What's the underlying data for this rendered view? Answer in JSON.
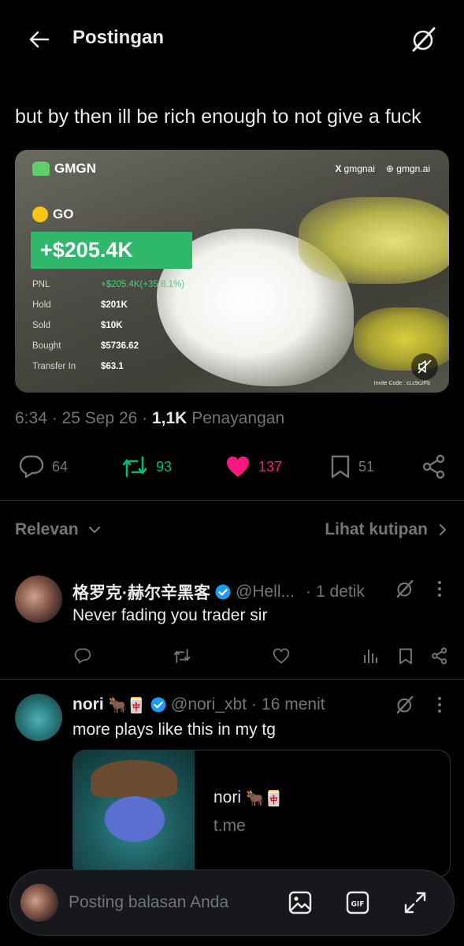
{
  "header": {
    "title": "Postingan",
    "back_icon": "arrow-left-icon",
    "grok_icon": "grok-icon"
  },
  "post": {
    "text": "but by then ill be rich enough to not give a fuck",
    "media": {
      "brand": "GMGN",
      "link1": "gmgnai",
      "link2": "gmgn.ai",
      "token": "GO",
      "pnl_big": "+$205.4K",
      "rows": [
        {
          "label": "PNL",
          "value": "+$205.4K(+35.8.1%)"
        },
        {
          "label": "Hold",
          "value": "$201K"
        },
        {
          "label": "Sold",
          "value": "$10K"
        },
        {
          "label": "Bought",
          "value": "$5736.62"
        },
        {
          "label": "Transfer In",
          "value": "$63.1"
        }
      ],
      "invite": "Invite Code : cLc9czFb"
    },
    "time": "6:34",
    "date": "25 Sep 26",
    "views": "1,1K",
    "views_label": "Penayangan",
    "stats": {
      "replies": "64",
      "reposts": "93",
      "likes": "137",
      "bookmarks": "51"
    },
    "colors": {
      "repost": "#00ba7c",
      "like": "#f91880"
    }
  },
  "sort": {
    "left": "Relevan",
    "right": "Lihat kutipan"
  },
  "replies": [
    {
      "name": "格罗克·赫尔辛黑客",
      "handle": "@Hell...",
      "time": "1 detik",
      "text": "Never fading you trader sir"
    },
    {
      "name": "nori",
      "name_emoji": "🐂🀄",
      "handle": "@nori_xbt",
      "time": "16 menit",
      "text": "more plays like this in my tg",
      "card": {
        "title": "nori",
        "title_emoji": "🐂🀄",
        "domain": "t.me"
      }
    }
  ],
  "composer": {
    "placeholder": "Posting balasan Anda"
  }
}
